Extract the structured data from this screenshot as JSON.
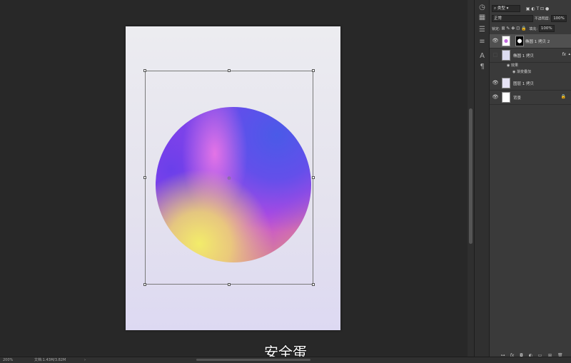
{
  "subtitle": "安全蛋",
  "status": {
    "zoom": "200%",
    "doc": "文档:1.43M/3.82M"
  },
  "layers_panel": {
    "filter_kind": "类型",
    "blend_mode": "正常",
    "opacity_label": "不透明度:",
    "opacity_value": "100%",
    "lock_label": "锁定:",
    "fill_label": "填充:",
    "fill_value": "100%",
    "layers": [
      {
        "name": "椭圆 1 拷贝 2",
        "visible": true,
        "selected": true
      },
      {
        "name": "椭圆 1 拷贝",
        "visible": false,
        "selected": false,
        "fx": "fx",
        "effects_label": "效果",
        "effect": "渐变叠加"
      },
      {
        "name": "图层 1 拷贝",
        "visible": true,
        "selected": false
      },
      {
        "name": "背景",
        "visible": true,
        "selected": false,
        "locked": true
      }
    ]
  },
  "colors": {
    "workspace": "#282828",
    "panel": "#3a3a3a",
    "selected_layer": "#505050"
  },
  "icons": [
    "eye-icon",
    "lock-icon",
    "fx-icon",
    "link-icon",
    "new-layer-icon",
    "trash-icon",
    "folder-icon",
    "mask-icon",
    "adjustment-icon",
    "search-icon"
  ]
}
